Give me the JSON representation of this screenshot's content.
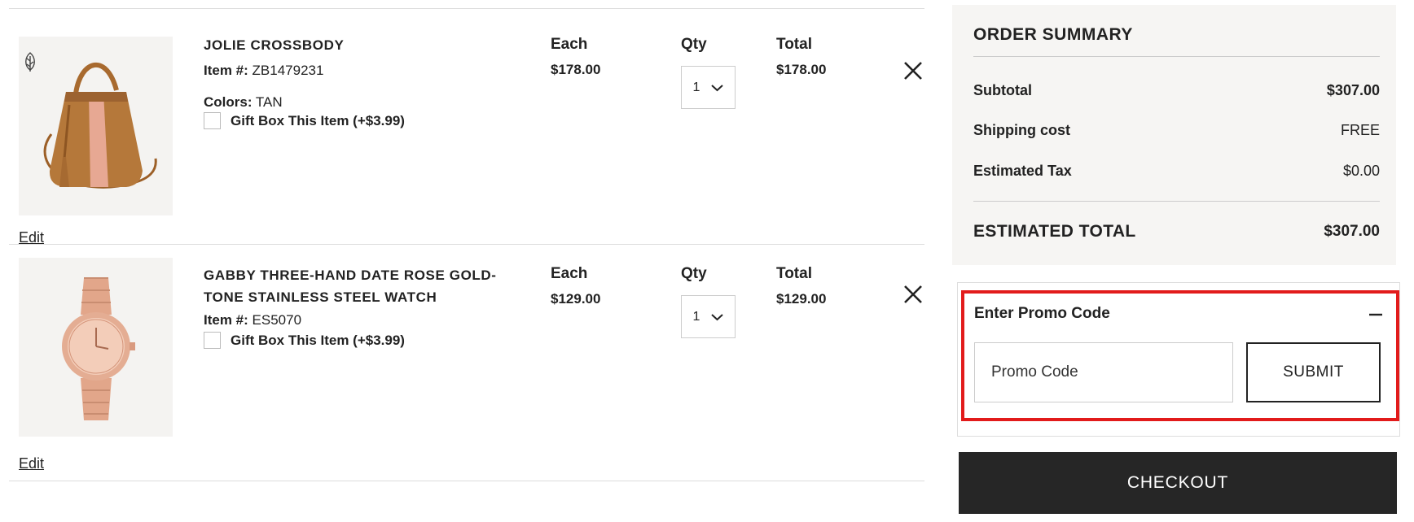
{
  "cart": {
    "items": [
      {
        "name": "JOLIE CROSSBODY",
        "item_label": "Item #:",
        "item_number": "ZB1479231",
        "colors_label": "Colors:",
        "color": "TAN",
        "gift_label": "Gift Box This Item (+$3.99)",
        "each_label": "Each",
        "each_price": "$178.00",
        "qty_label": "Qty",
        "qty_value": "1",
        "total_label": "Total",
        "total_price": "$178.00",
        "edit_label": "Edit",
        "image_icon": "crossbody-bag-image",
        "badge_icon": "leaf-icon"
      },
      {
        "name": "GABBY THREE-HAND DATE ROSE GOLD-TONE STAINLESS STEEL WATCH",
        "name_line1": "GABBY THREE-HAND DATE ROSE GOLD-",
        "name_line2": "TONE STAINLESS STEEL WATCH",
        "item_label": "Item #:",
        "item_number": "ES5070",
        "gift_label": "Gift Box This Item (+$3.99)",
        "each_label": "Each",
        "each_price": "$129.00",
        "qty_label": "Qty",
        "qty_value": "1",
        "total_label": "Total",
        "total_price": "$129.00",
        "edit_label": "Edit",
        "image_icon": "watch-image"
      }
    ]
  },
  "summary": {
    "title": "ORDER SUMMARY",
    "rows": [
      {
        "label": "Subtotal",
        "value": "$307.00"
      },
      {
        "label": "Shipping cost",
        "value": "FREE"
      },
      {
        "label": "Estimated Tax",
        "value": "$0.00"
      }
    ],
    "total_label": "ESTIMATED TOTAL",
    "total_value": "$307.00"
  },
  "promo": {
    "title": "Enter Promo Code",
    "placeholder": "Promo Code",
    "submit_label": "SUBMIT",
    "toggle_icon": "minus-icon"
  },
  "checkout": {
    "label": "CHECKOUT"
  },
  "colors": {
    "highlight": "#e21b1b",
    "checkout_bg": "#262626",
    "summary_bg": "#f6f5f3",
    "bag_tan": "#b5783a",
    "bag_stripe": "#e7a893",
    "watch_rose_gold": "#e2a68a"
  }
}
